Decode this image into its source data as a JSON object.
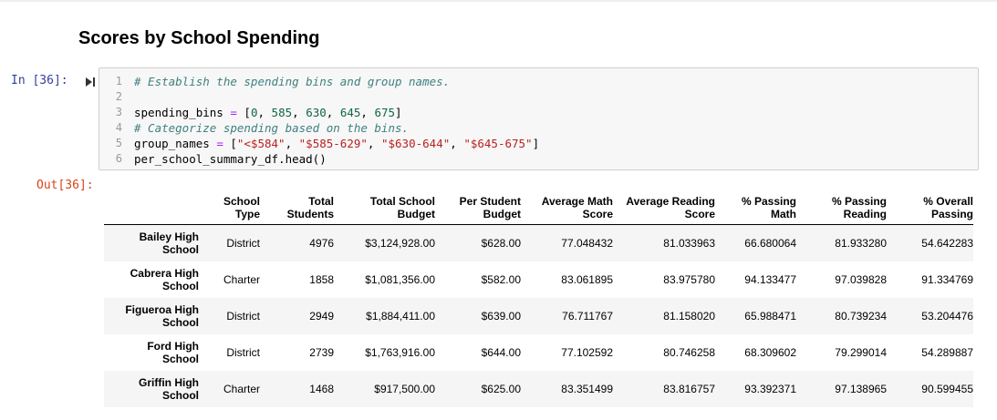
{
  "section_heading": "Scores by School Spending",
  "input_prompt": "In [36]:",
  "output_prompt": "Out[36]:",
  "code_lines": [
    {
      "n": "1",
      "parts": [
        {
          "t": "# Establish the spending bins and group names.",
          "c": "cm"
        }
      ]
    },
    {
      "n": "2",
      "parts": []
    },
    {
      "n": "3",
      "parts": [
        {
          "t": "spending_bins ",
          "c": ""
        },
        {
          "t": "=",
          "c": "op"
        },
        {
          "t": " [",
          "c": ""
        },
        {
          "t": "0",
          "c": "num"
        },
        {
          "t": ", ",
          "c": ""
        },
        {
          "t": "585",
          "c": "num"
        },
        {
          "t": ", ",
          "c": ""
        },
        {
          "t": "630",
          "c": "num"
        },
        {
          "t": ", ",
          "c": ""
        },
        {
          "t": "645",
          "c": "num"
        },
        {
          "t": ", ",
          "c": ""
        },
        {
          "t": "675",
          "c": "num"
        },
        {
          "t": "]",
          "c": ""
        }
      ]
    },
    {
      "n": "4",
      "parts": [
        {
          "t": "# Categorize spending based on the bins.",
          "c": "cm"
        }
      ]
    },
    {
      "n": "5",
      "parts": [
        {
          "t": "group_names ",
          "c": ""
        },
        {
          "t": "=",
          "c": "op"
        },
        {
          "t": " [",
          "c": ""
        },
        {
          "t": "\"<$584\"",
          "c": "str"
        },
        {
          "t": ", ",
          "c": ""
        },
        {
          "t": "\"$585-629\"",
          "c": "str"
        },
        {
          "t": ", ",
          "c": ""
        },
        {
          "t": "\"$630-644\"",
          "c": "str"
        },
        {
          "t": ", ",
          "c": ""
        },
        {
          "t": "\"$645-675\"",
          "c": "str"
        },
        {
          "t": "]",
          "c": ""
        }
      ]
    },
    {
      "n": "6",
      "parts": [
        {
          "t": "per_school_summary_df.head()",
          "c": ""
        }
      ]
    }
  ],
  "table": {
    "columns": [
      {
        "label": "",
        "width": 104
      },
      {
        "label": "School\nType",
        "width": 67
      },
      {
        "label": "Total\nStudents",
        "width": 81
      },
      {
        "label": "Total School\nBudget",
        "width": 111
      },
      {
        "label": "Per Student\nBudget",
        "width": 94
      },
      {
        "label": "Average Math\nScore",
        "width": 101
      },
      {
        "label": "Average Reading\nScore",
        "width": 112
      },
      {
        "label": "% Passing\nMath",
        "width": 89
      },
      {
        "label": "% Passing\nReading",
        "width": 99
      },
      {
        "label": "% Overall\nPassing",
        "width": 95
      }
    ],
    "rows": [
      {
        "name": "Bailey High\nSchool",
        "cells": [
          "District",
          "4976",
          "$3,124,928.00",
          "$628.00",
          "77.048432",
          "81.033963",
          "66.680064",
          "81.933280",
          "54.642283"
        ]
      },
      {
        "name": "Cabrera High\nSchool",
        "cells": [
          "Charter",
          "1858",
          "$1,081,356.00",
          "$582.00",
          "83.061895",
          "83.975780",
          "94.133477",
          "97.039828",
          "91.334769"
        ]
      },
      {
        "name": "Figueroa High\nSchool",
        "cells": [
          "District",
          "2949",
          "$1,884,411.00",
          "$639.00",
          "76.711767",
          "81.158020",
          "65.988471",
          "80.739234",
          "53.204476"
        ]
      },
      {
        "name": "Ford High\nSchool",
        "cells": [
          "District",
          "2739",
          "$1,763,916.00",
          "$644.00",
          "77.102592",
          "80.746258",
          "68.309602",
          "79.299014",
          "54.289887"
        ]
      },
      {
        "name": "Griffin High\nSchool",
        "cells": [
          "Charter",
          "1468",
          "$917,500.00",
          "$625.00",
          "83.351499",
          "83.816757",
          "93.392371",
          "97.138965",
          "90.599455"
        ]
      }
    ]
  }
}
